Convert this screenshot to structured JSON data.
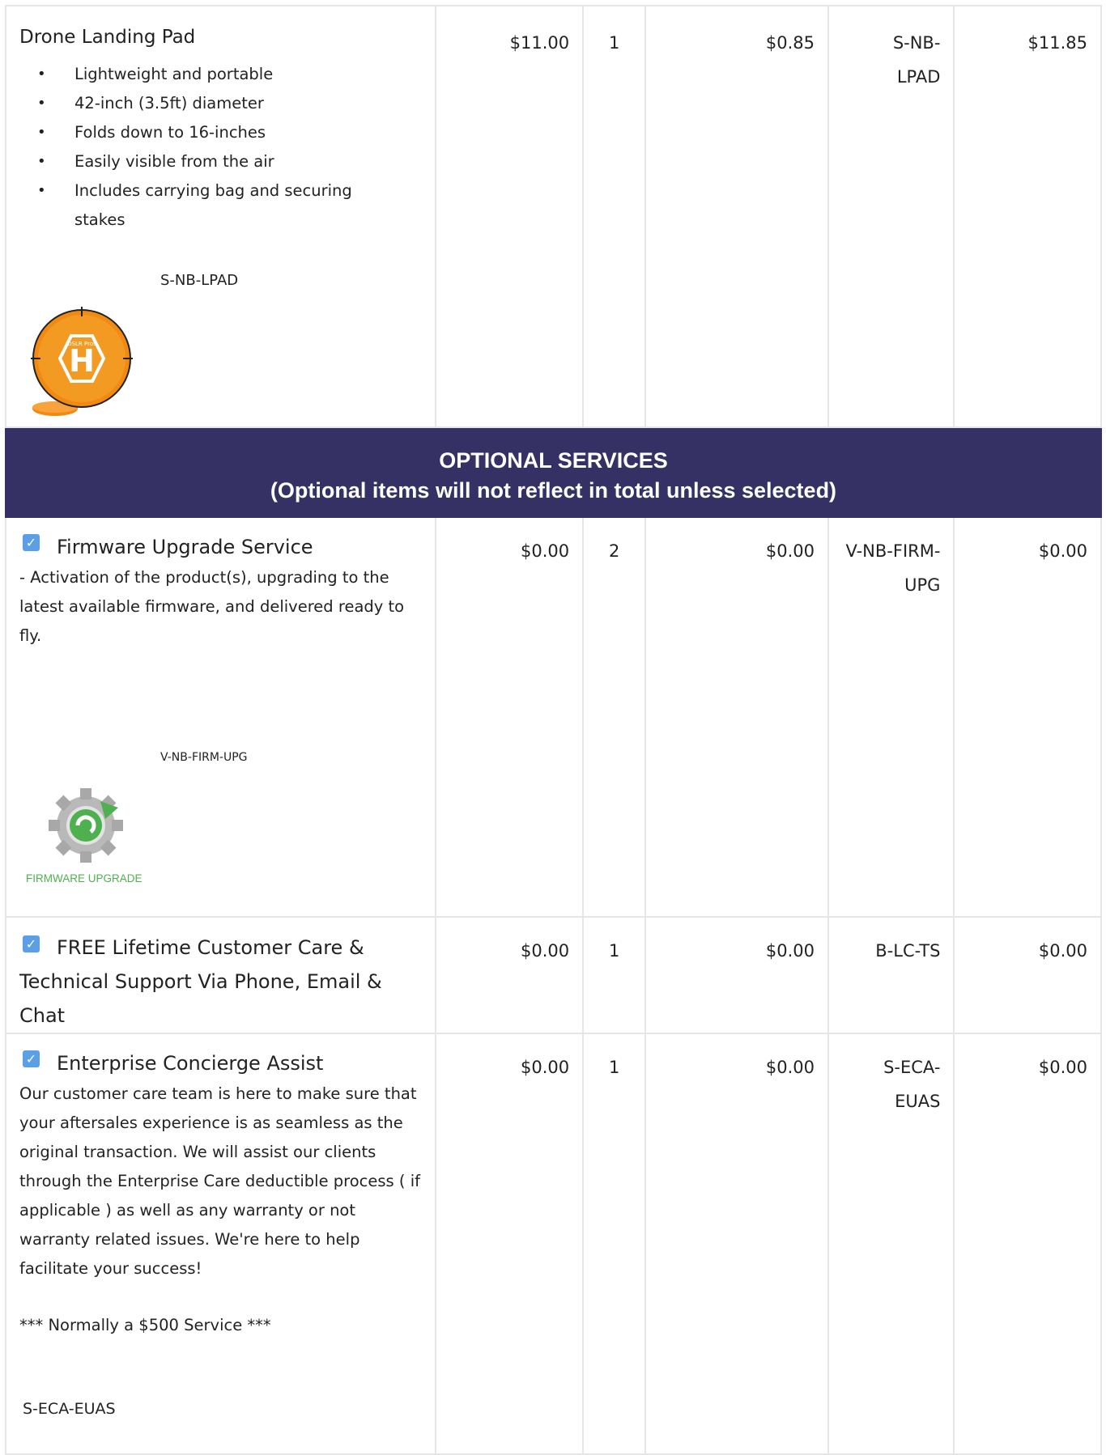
{
  "products": [
    {
      "title": "Drone Landing Pad",
      "features": [
        "Lightweight and portable",
        "42-inch (3.5ft) diameter",
        "Folds down to 16-inches",
        "Easily visible from the air",
        "Includes carrying bag and securing stakes"
      ],
      "sku_caption": "S-NB-LPAD",
      "image_logo_text": "DSLR Pros",
      "image_letter": "H",
      "price": "$11.00",
      "qty": "1",
      "tax": "$0.85",
      "sku": "S-NB-LPAD",
      "total": "$11.85"
    }
  ],
  "banner": {
    "line1": "OPTIONAL SERVICES",
    "line2": "(Optional items will not reflect in total unless selected)"
  },
  "services": [
    {
      "title": "Firmware Upgrade Service",
      "desc": "- Activation of the product(s), upgrading to the latest available firmware, and delivered ready to fly.",
      "sku_caption": "V-NB-FIRM-UPG",
      "image_label": "FIRMWARE UPGRADE",
      "price": "$0.00",
      "qty": "2",
      "tax": "$0.00",
      "sku": "V-NB-FIRM-UPG",
      "total": "$0.00",
      "checked": true
    },
    {
      "title": "FREE Lifetime Customer Care & Technical Support Via Phone, Email & Chat",
      "price": "$0.00",
      "qty": "1",
      "tax": "$0.00",
      "sku": "B-LC-TS",
      "total": "$0.00",
      "checked": true
    },
    {
      "title": "Enterprise Concierge Assist",
      "desc": "Our customer care team is here to make sure that your aftersales experience is as seamless as the original transaction. We will assist our clients through the Enterprise Care deductible process ( if applicable ) as well as any warranty or not warranty related issues. We're here to help facilitate your success!",
      "note": "*** Normally a $500 Service ***",
      "sku_caption": "S-ECA-EUAS",
      "price": "$0.00",
      "qty": "1",
      "tax": "$0.00",
      "sku": "S-ECA-EUAS",
      "total": "$0.00",
      "checked": true
    }
  ],
  "colors": {
    "banner_bg": "#353164",
    "checkbox": "#5b9fe6",
    "pad_orange": "#f28a12",
    "firmware_green": "#4fb04f"
  }
}
